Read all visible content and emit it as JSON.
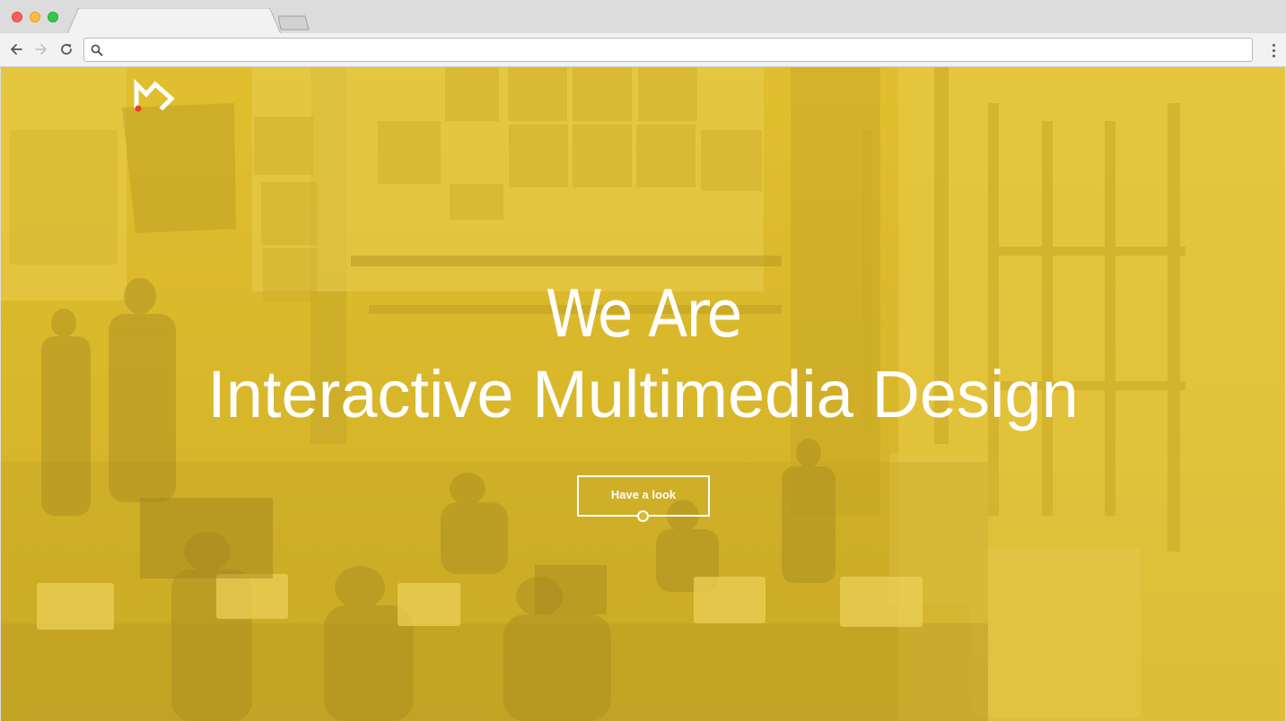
{
  "browser": {
    "url_value": "",
    "url_placeholder": "",
    "tab_title": ""
  },
  "hero": {
    "line1": "We Are",
    "line2": "Interactive Multimedia Design",
    "cta_label": "Have a look"
  },
  "colors": {
    "overlay": "#e7c334",
    "text": "#ffffff",
    "logo_accent": "#e8402a"
  }
}
